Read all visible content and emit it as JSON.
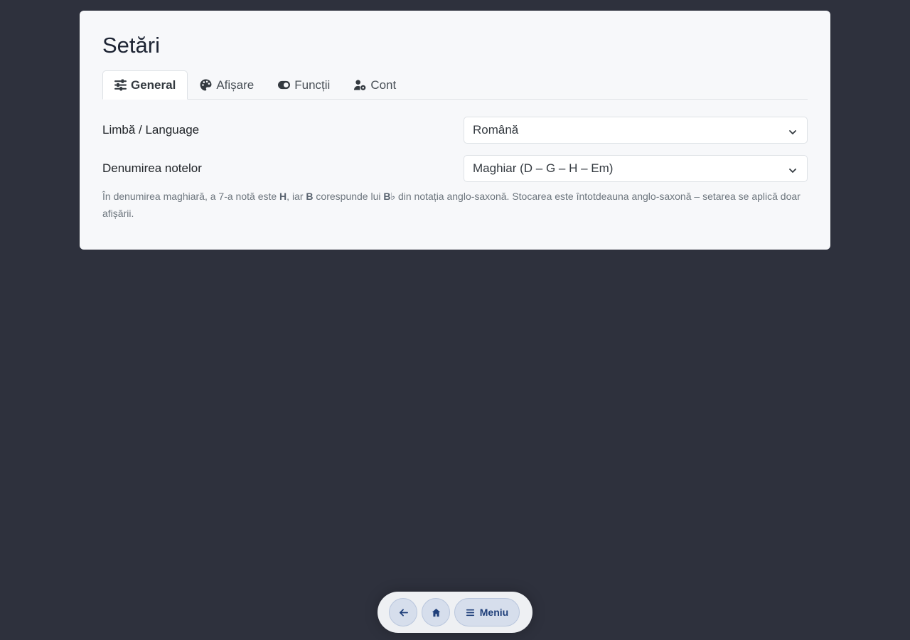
{
  "page": {
    "title": "Setări"
  },
  "tabs": [
    {
      "label": "General",
      "icon": "sliders-icon",
      "active": true
    },
    {
      "label": "Afișare",
      "icon": "palette-icon",
      "active": false
    },
    {
      "label": "Funcții",
      "icon": "toggle-icon",
      "active": false
    },
    {
      "label": "Cont",
      "icon": "user-gear-icon",
      "active": false
    }
  ],
  "settings": {
    "language": {
      "label": "Limbă / Language",
      "value": "Română"
    },
    "note_naming": {
      "label": "Denumirea notelor",
      "value": "Maghiar (D – G – H – Em)",
      "help": {
        "t1": "În denumirea maghiară, a 7-a notă este ",
        "b1": "H",
        "t2": ", iar ",
        "b2": "B",
        "t3": " corespunde lui ",
        "b3": "B♭",
        "t4": " din notația anglo-saxonă. Stocarea este întotdeauna anglo-saxonă – setarea se aplică doar afișării."
      }
    }
  },
  "bottom_nav": {
    "back_icon": "arrow-left-icon",
    "home_icon": "home-icon",
    "menu_icon": "bars-icon",
    "menu_label": "Meniu"
  },
  "colors": {
    "background": "#2e313d",
    "card": "#f7f8fa",
    "accent": "#1f3f7a"
  }
}
